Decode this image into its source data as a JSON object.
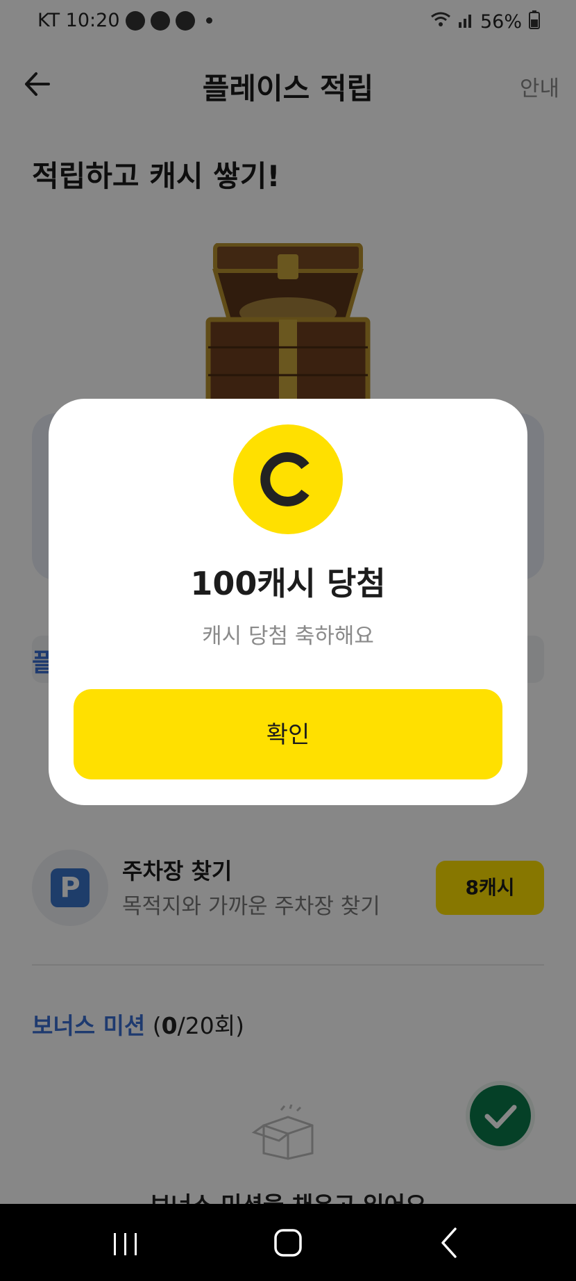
{
  "status_bar": {
    "carrier_time": "KT 10:20",
    "battery": "56%"
  },
  "header": {
    "title": "플레이스 적립",
    "guide_label": "안내"
  },
  "headline": "적립하고 캐시 쌓기!",
  "section_fragment": "플",
  "missions": [
    {
      "title": "주차장 찾기",
      "subtitle": "목적지와 가까운 주차장 찾기",
      "reward": "8캐시",
      "icon": "parking-icon"
    }
  ],
  "bonus": {
    "label": "보너스 미션",
    "count_open": " (",
    "count_current": "0",
    "count_rest": "/20회)",
    "message": "보너스 미션을 채우고 있어요"
  },
  "dialog": {
    "title": "100캐시 당첨",
    "subtitle": "캐시 당첨 축하해요",
    "confirm_label": "확인"
  },
  "colors": {
    "accent_yellow": "#ffe000",
    "brand_blue": "#3a6fd1",
    "fab_green": "#0b7a4b",
    "overlay": "rgba(0,0,0,0.47)"
  }
}
